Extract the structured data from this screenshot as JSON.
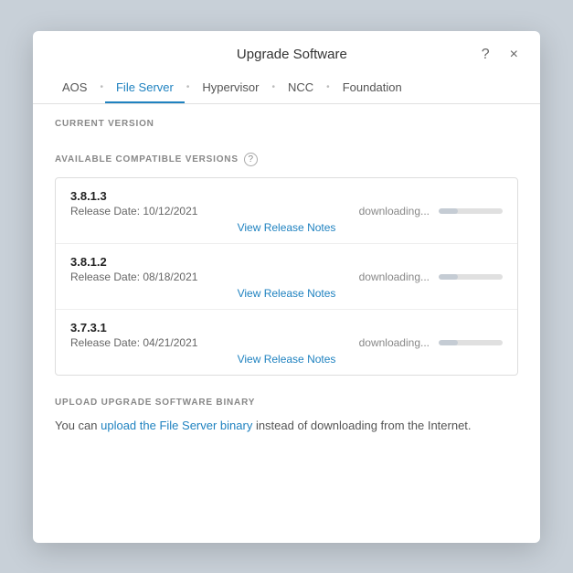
{
  "dialog": {
    "title": "Upgrade Software",
    "help_label": "?",
    "close_label": "×"
  },
  "tabs": [
    {
      "id": "aos",
      "label": "AOS",
      "active": false
    },
    {
      "id": "file-server",
      "label": "File Server",
      "active": true
    },
    {
      "id": "hypervisor",
      "label": "Hypervisor",
      "active": false
    },
    {
      "id": "ncc",
      "label": "NCC",
      "active": false
    },
    {
      "id": "foundation",
      "label": "Foundation",
      "active": false
    }
  ],
  "sections": {
    "current_version_label": "CURRENT VERSION",
    "available_label": "AVAILABLE COMPATIBLE VERSIONS",
    "upload_label": "UPLOAD UPGRADE SOFTWARE BINARY"
  },
  "versions": [
    {
      "number": "3.8.1.3",
      "release_date": "Release Date: 10/12/2021",
      "download_status": "downloading...",
      "progress": 30,
      "view_notes_label": "View Release Notes"
    },
    {
      "number": "3.8.1.2",
      "release_date": "Release Date: 08/18/2021",
      "download_status": "downloading...",
      "progress": 30,
      "view_notes_label": "View Release Notes"
    },
    {
      "number": "3.7.3.1",
      "release_date": "Release Date: 04/21/2021",
      "download_status": "downloading...",
      "progress": 30,
      "view_notes_label": "View Release Notes"
    }
  ],
  "upload": {
    "prefix_text": "You can ",
    "link_text": "upload the File Server binary",
    "suffix_text": " instead of downloading from the Internet."
  }
}
